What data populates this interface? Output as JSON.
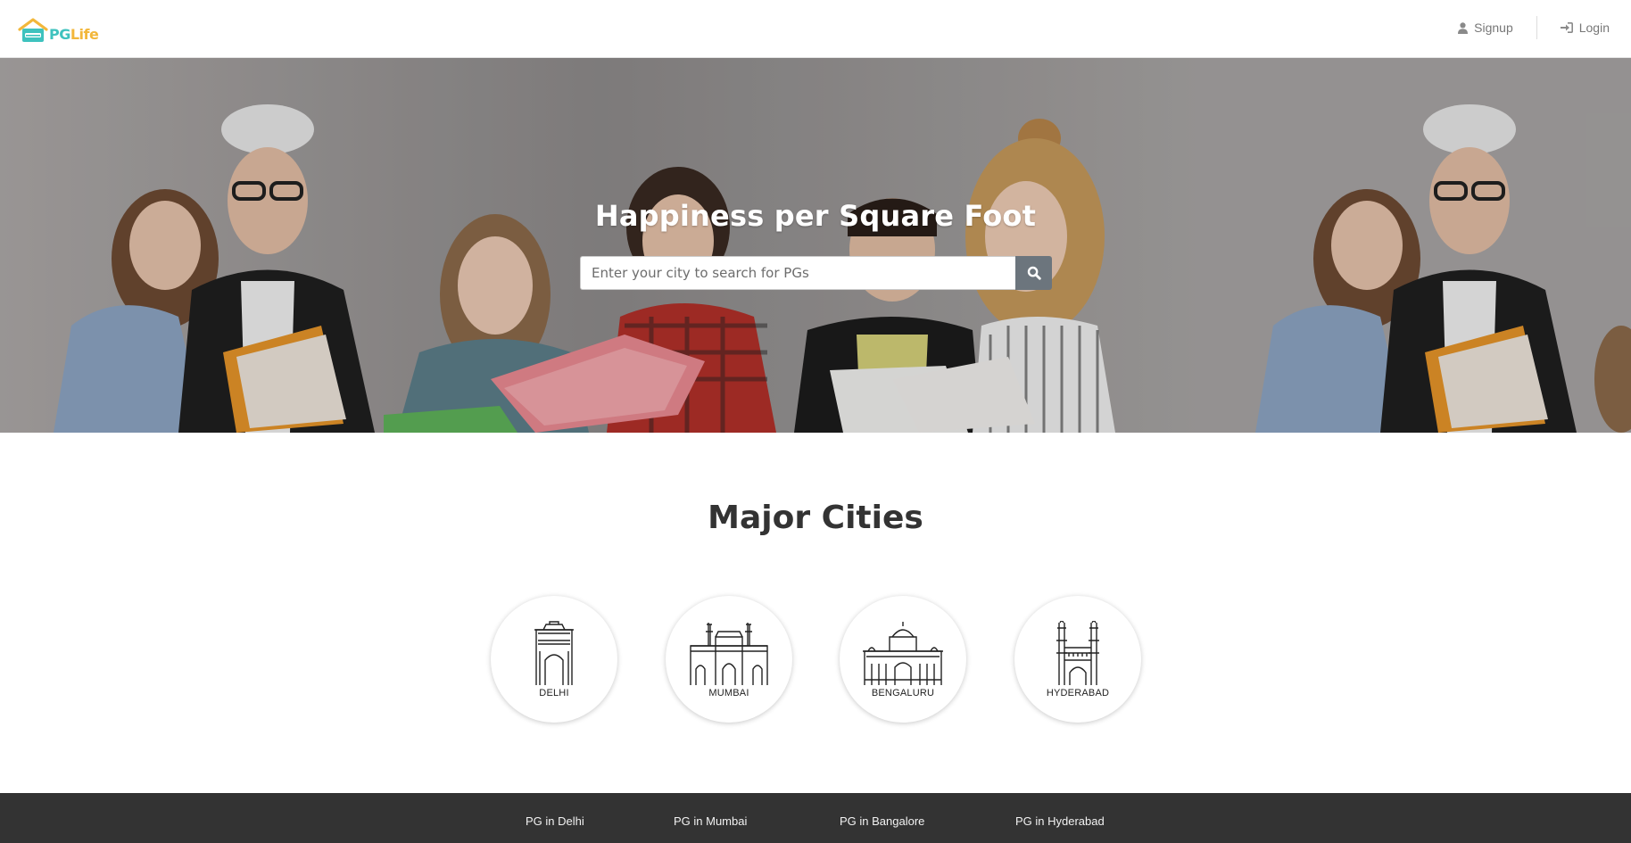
{
  "brand": {
    "name_part1": "PG",
    "name_part2": "Life",
    "color_primary": "#3ec2be",
    "color_secondary": "#f2b73b"
  },
  "header": {
    "nav": [
      {
        "label": "Signup",
        "icon": "user-icon"
      },
      {
        "label": "Login",
        "icon": "sign-in-icon"
      }
    ]
  },
  "banner": {
    "title": "Happiness per Square Foot",
    "search": {
      "placeholder": "Enter your city to search for PGs",
      "value": "",
      "button_icon": "search-icon"
    }
  },
  "cities": {
    "title": "Major Cities",
    "items": [
      {
        "label": "DELHI",
        "icon": "india-gate-icon"
      },
      {
        "label": "MUMBAI",
        "icon": "gateway-of-india-icon"
      },
      {
        "label": "BENGALURU",
        "icon": "vidhana-soudha-icon"
      },
      {
        "label": "HYDERABAD",
        "icon": "charminar-icon"
      }
    ]
  },
  "footer": {
    "links": [
      "PG in Delhi",
      "PG in Mumbai",
      "PG in Bangalore",
      "PG in Hyderabad"
    ],
    "background": "#333333"
  }
}
